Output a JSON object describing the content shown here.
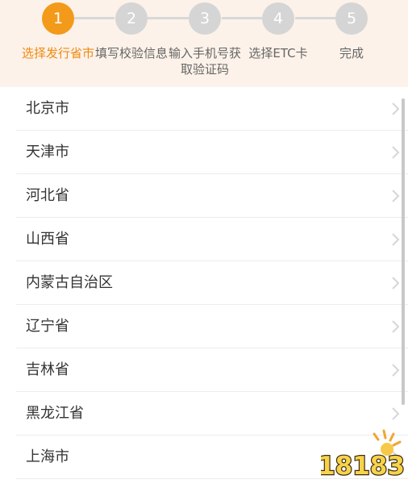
{
  "stepper": {
    "steps": [
      {
        "number": "1",
        "label": "选择发行省市",
        "active": true
      },
      {
        "number": "2",
        "label": "填写校验信息",
        "active": false
      },
      {
        "number": "3",
        "label": "输入手机号获取验证码",
        "active": false
      },
      {
        "number": "4",
        "label": "选择ETC卡",
        "active": false
      },
      {
        "number": "5",
        "label": "完成",
        "active": false
      }
    ],
    "colors": {
      "active": "#f39a1b",
      "inactive": "#d5d5d5",
      "background": "#fcf2e9",
      "active_text": "#f08a12"
    }
  },
  "provinces": [
    {
      "name": "北京市",
      "icon": "chevron-right-icon"
    },
    {
      "name": "天津市",
      "icon": "chevron-right-icon"
    },
    {
      "name": "河北省",
      "icon": "chevron-right-icon"
    },
    {
      "name": "山西省",
      "icon": "chevron-right-icon"
    },
    {
      "name": "内蒙古自治区",
      "icon": "chevron-right-icon"
    },
    {
      "name": "辽宁省",
      "icon": "chevron-right-icon"
    },
    {
      "name": "吉林省",
      "icon": "chevron-right-icon"
    },
    {
      "name": "黑龙江省",
      "icon": "chevron-right-icon"
    },
    {
      "name": "上海市",
      "icon": "chevron-right-icon"
    }
  ],
  "watermark": {
    "text": "18183"
  }
}
